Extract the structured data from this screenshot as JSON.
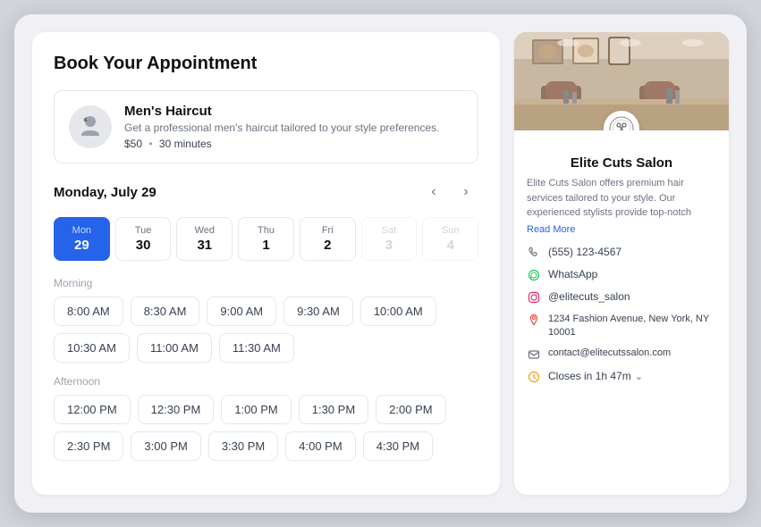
{
  "page": {
    "title": "Book Your Appointment",
    "background": "#f0f0f5"
  },
  "service": {
    "name": "Men's Haircut",
    "description": "Get a professional men's haircut tailored to your style preferences.",
    "price": "$50",
    "duration": "30 minutes"
  },
  "calendar": {
    "date_label": "Monday, July 29",
    "days": [
      {
        "name": "Mon",
        "num": "29",
        "active": true,
        "disabled": false
      },
      {
        "name": "Tue",
        "num": "30",
        "active": false,
        "disabled": false
      },
      {
        "name": "Wed",
        "num": "31",
        "active": false,
        "disabled": false
      },
      {
        "name": "Thu",
        "num": "1",
        "active": false,
        "disabled": false
      },
      {
        "name": "Fri",
        "num": "2",
        "active": false,
        "disabled": false
      },
      {
        "name": "Sat",
        "num": "3",
        "active": false,
        "disabled": true
      },
      {
        "name": "Sun",
        "num": "4",
        "active": false,
        "disabled": true
      }
    ],
    "prev_label": "‹",
    "next_label": "›"
  },
  "time_slots": {
    "morning_label": "Morning",
    "morning_slots": [
      "8:00 AM",
      "8:30 AM",
      "9:00 AM",
      "9:30 AM",
      "10:00 AM",
      "10:30 AM",
      "11:00 AM",
      "11:30 AM"
    ],
    "afternoon_label": "Afternoon",
    "afternoon_slots": [
      "12:00 PM",
      "12:30 PM",
      "1:00 PM",
      "1:30 PM",
      "2:00 PM",
      "2:30 PM",
      "3:00 PM",
      "3:30 PM",
      "4:00 PM",
      "4:30 PM"
    ]
  },
  "salon": {
    "name": "Elite Cuts Salon",
    "description": "Elite Cuts Salon offers premium hair services tailored to your style. Our experienced stylists provide top-notch",
    "read_more": "Read More",
    "phone": "(555) 123-4567",
    "whatsapp": "WhatsApp",
    "instagram": "@elitecuts_salon",
    "address": "1234 Fashion Avenue, New York, NY 10001",
    "email": "contact@elitecutssalon.com",
    "hours": "Closes in 1h 47m"
  }
}
